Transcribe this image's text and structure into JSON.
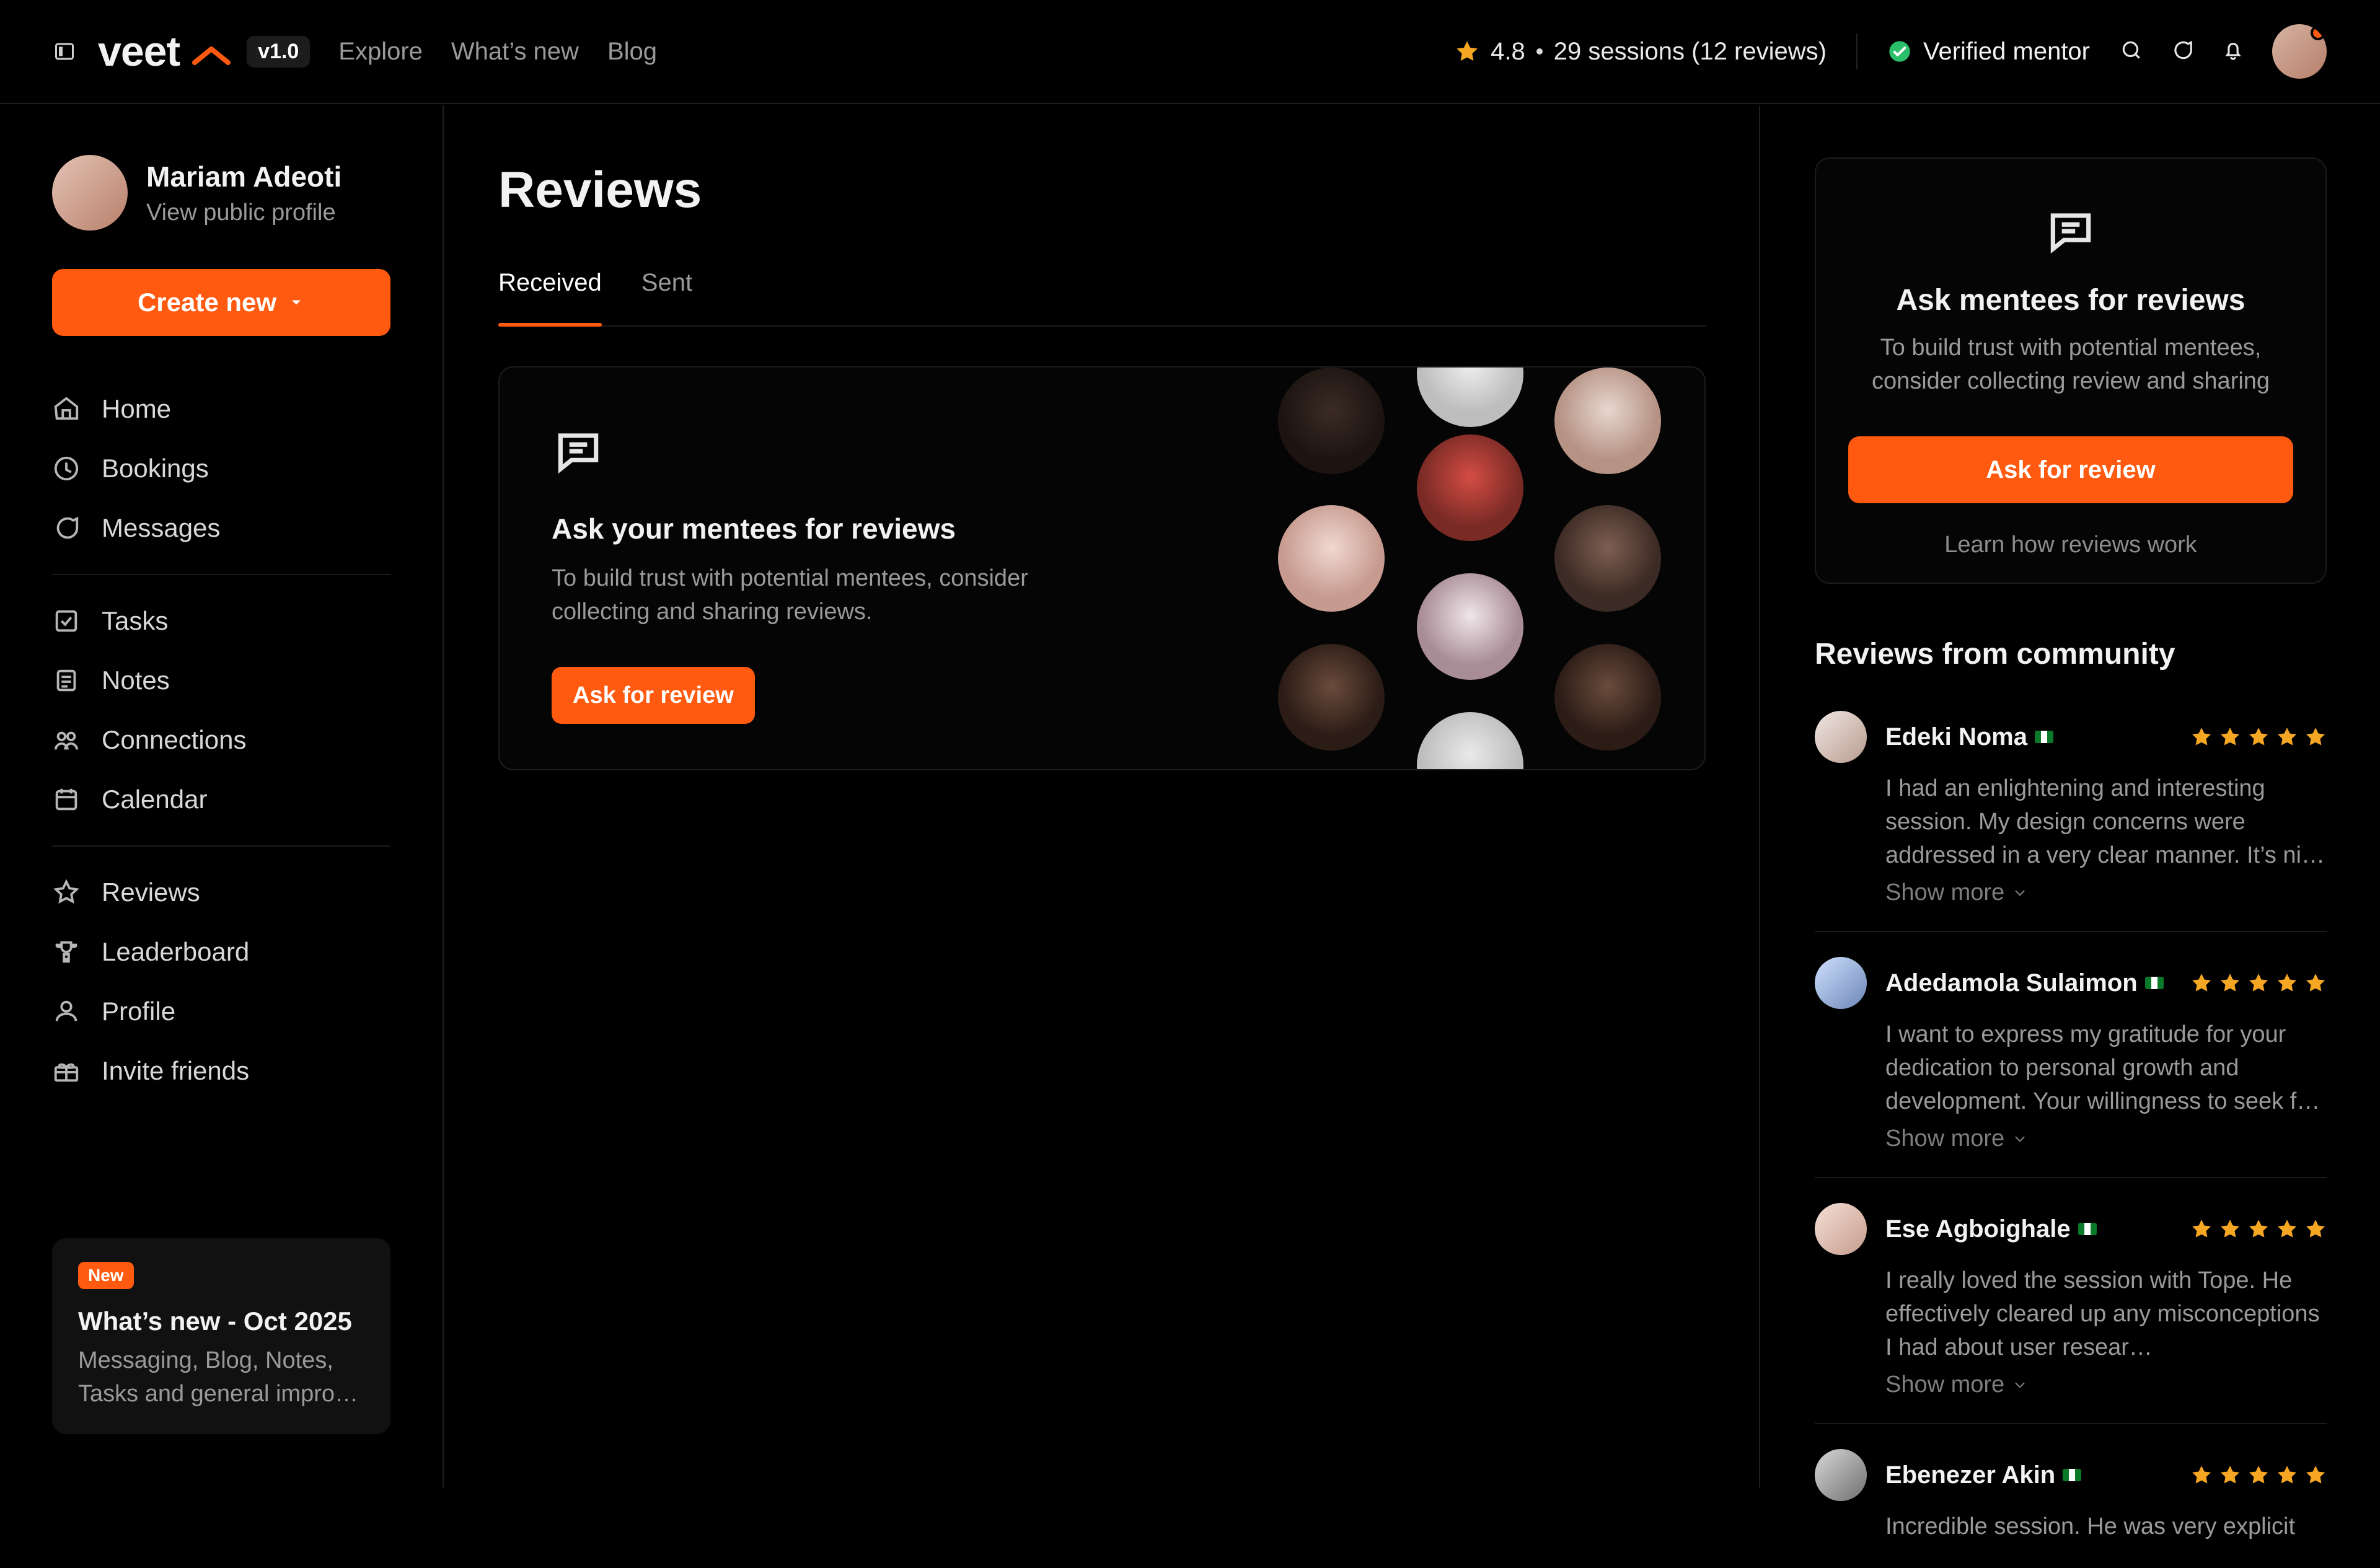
{
  "app": {
    "logo_text": "veet",
    "version": "v1.0",
    "nav": [
      "Explore",
      "What’s new",
      "Blog"
    ],
    "rating_value": "4.8",
    "sessions_text": "29 sessions (12 reviews)",
    "verified_text": "Verified mentor"
  },
  "sidebar": {
    "user_name": "Mariam Adeoti",
    "user_sub": "View public profile",
    "create_label": "Create new",
    "menu1": [
      "Home",
      "Bookings",
      "Messages"
    ],
    "menu2": [
      "Tasks",
      "Notes",
      "Connections",
      "Calendar"
    ],
    "menu3": [
      "Reviews",
      "Leaderboard",
      "Profile",
      "Invite friends"
    ],
    "whats_new": {
      "badge": "New",
      "title": "What’s new - Oct 2025",
      "text": "Messaging, Blog, Notes, Tasks and general impro…"
    }
  },
  "main": {
    "title": "Reviews",
    "tabs": [
      "Received",
      "Sent"
    ],
    "hero": {
      "title": "Ask your mentees for reviews",
      "text": "To build trust with potential mentees, consider collecting and sharing reviews.",
      "button": "Ask for review"
    }
  },
  "right": {
    "card": {
      "title": "Ask mentees for reviews",
      "text": "To build trust with potential mentees, consider collecting review and sharing",
      "button": "Ask for review",
      "link": "Learn how reviews work"
    },
    "community_title": "Reviews from community",
    "reviews": [
      {
        "name": "Edeki Noma",
        "text": "I had an enlightening and interesting session. My design concerns were addressed in a very clear manner. It’s ni…",
        "more": "Show more",
        "stars": 5
      },
      {
        "name": "Adedamola Sulaimon",
        "text": "I want to express my gratitude for your dedication to personal growth and development. Your willingness to seek f…",
        "more": "Show more",
        "stars": 5
      },
      {
        "name": "Ese Agboighale",
        "text": "I really loved the session with Tope. He effectively cleared up any misconceptions I had about user resear…",
        "more": "Show more",
        "stars": 5
      },
      {
        "name": "Ebenezer Akin",
        "text": "Incredible session. He was very explicit",
        "more": "",
        "stars": 5
      }
    ]
  },
  "colors": {
    "accent": "#ff5a0f",
    "star": "#f5a623",
    "verified": "#2ac06b"
  }
}
